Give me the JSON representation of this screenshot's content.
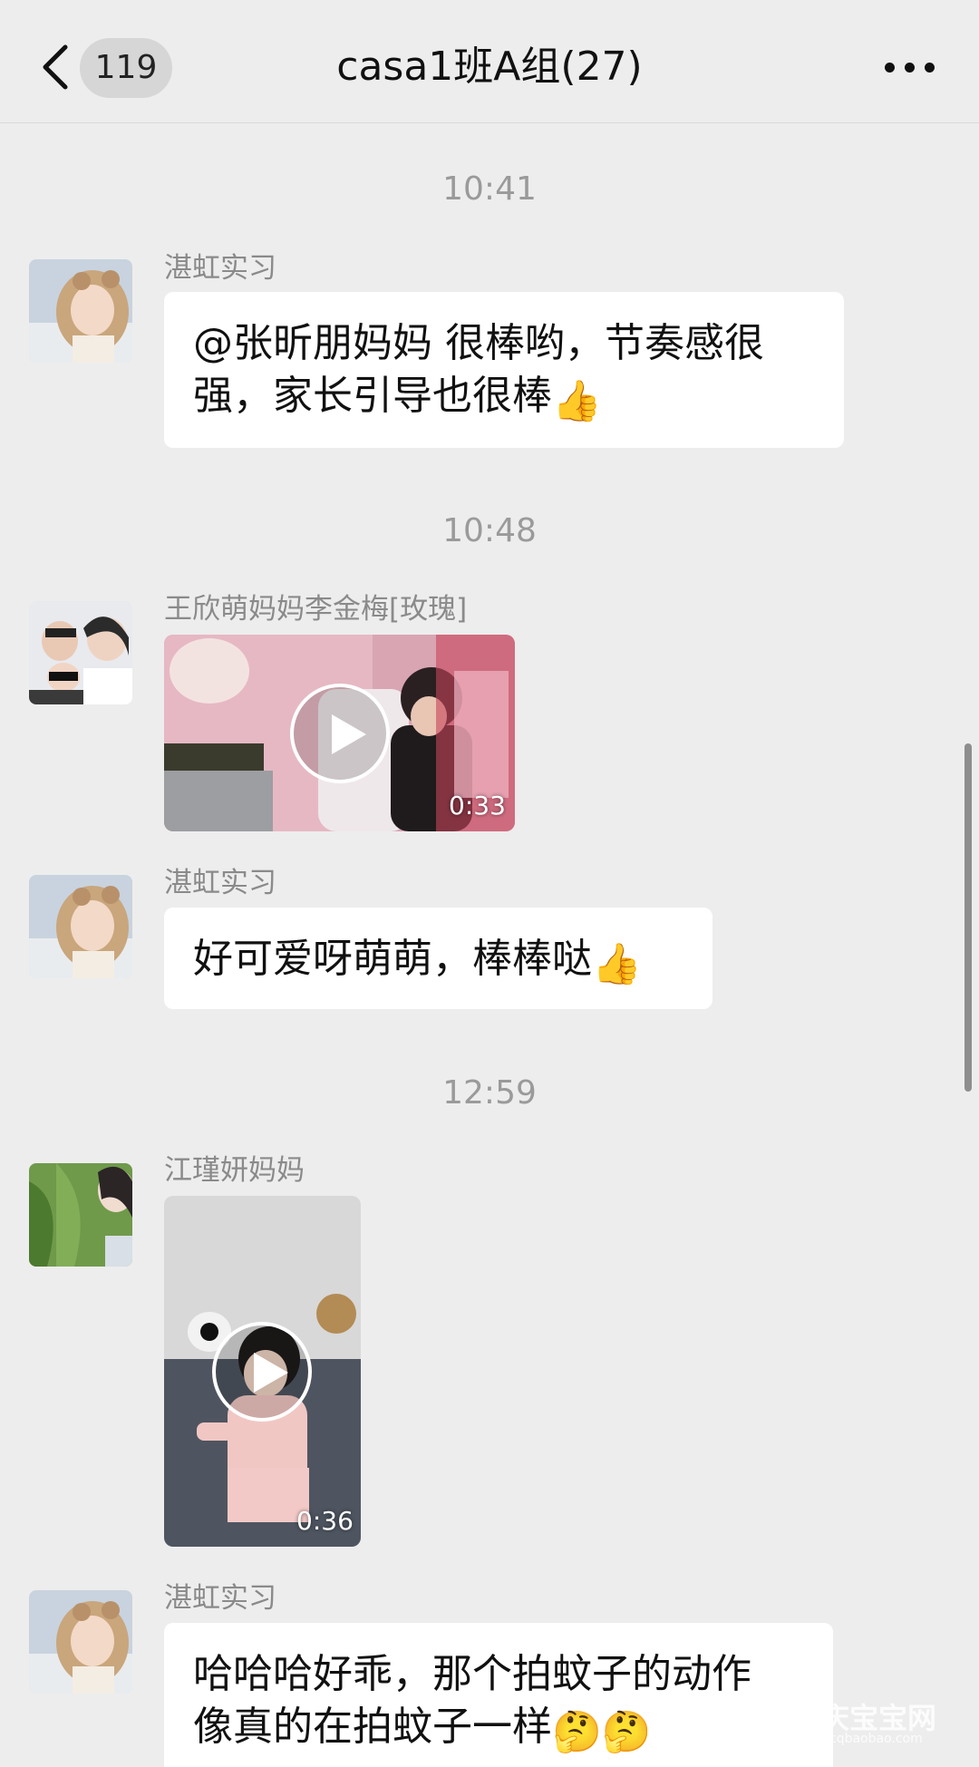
{
  "header": {
    "back_count": "119",
    "title": "casa1班A组(27)"
  },
  "messages": [
    {
      "type": "time",
      "text": "10:41"
    },
    {
      "type": "text",
      "sender": "湛虹实习",
      "line1": "@张昕朋妈妈 很棒哟，节奏感很",
      "line2": "强，家长引导也很棒",
      "emoji": "👍"
    },
    {
      "type": "time",
      "text": "10:48"
    },
    {
      "type": "video",
      "sender": "王欣萌妈妈李金梅[玫瑰]",
      "duration": "0:33"
    },
    {
      "type": "text",
      "sender": "湛虹实习",
      "line1": "好可爱呀萌萌，棒棒哒",
      "emoji": "👍"
    },
    {
      "type": "time",
      "text": "12:59"
    },
    {
      "type": "video",
      "sender": "江瑾妍妈妈",
      "duration": "0:36"
    },
    {
      "type": "text",
      "sender": "湛虹实习",
      "line1": "哈哈哈好乖，那个拍蚊子的动作",
      "line2": "像真的在拍蚊子一样",
      "emoji": "🤔🤔"
    }
  ],
  "watermark": {
    "main": "庆宝宝网",
    "sub": "cqbaobao.com"
  },
  "icons": {
    "back": "chevron-left-icon",
    "more": "more-dots-icon",
    "play": "play-icon"
  },
  "colors": {
    "background": "#ededed",
    "bubble": "#ffffff",
    "timestamp": "#9a9a9a",
    "sender": "#8a8a8a"
  }
}
